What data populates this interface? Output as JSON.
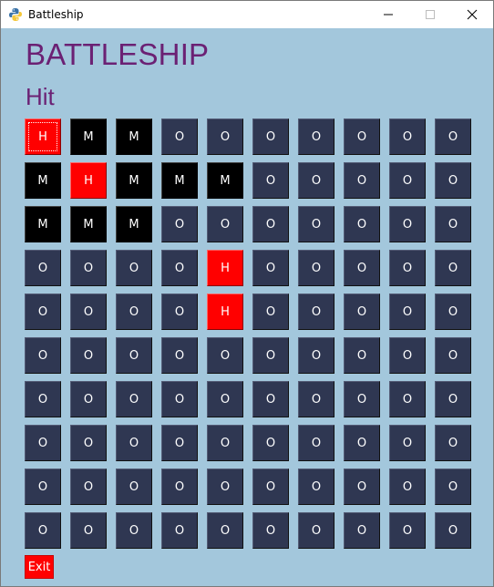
{
  "window": {
    "title": "Battleship",
    "icon": "python-icon"
  },
  "header": {
    "title": "BATTLESHIP",
    "status": "Hit"
  },
  "board": {
    "rows": [
      [
        "H",
        "M",
        "M",
        "O",
        "O",
        "O",
        "O",
        "O",
        "O",
        "O"
      ],
      [
        "M",
        "H",
        "M",
        "M",
        "M",
        "O",
        "O",
        "O",
        "O",
        "O"
      ],
      [
        "M",
        "M",
        "M",
        "O",
        "O",
        "O",
        "O",
        "O",
        "O",
        "O"
      ],
      [
        "O",
        "O",
        "O",
        "O",
        "H",
        "O",
        "O",
        "O",
        "O",
        "O"
      ],
      [
        "O",
        "O",
        "O",
        "O",
        "H",
        "O",
        "O",
        "O",
        "O",
        "O"
      ],
      [
        "O",
        "O",
        "O",
        "O",
        "O",
        "O",
        "O",
        "O",
        "O",
        "O"
      ],
      [
        "O",
        "O",
        "O",
        "O",
        "O",
        "O",
        "O",
        "O",
        "O",
        "O"
      ],
      [
        "O",
        "O",
        "O",
        "O",
        "O",
        "O",
        "O",
        "O",
        "O",
        "O"
      ],
      [
        "O",
        "O",
        "O",
        "O",
        "O",
        "O",
        "O",
        "O",
        "O",
        "O"
      ],
      [
        "O",
        "O",
        "O",
        "O",
        "O",
        "O",
        "O",
        "O",
        "O",
        "O"
      ]
    ],
    "colors": {
      "hit": "#ff0000",
      "miss": "#000000",
      "empty": "#2f3752"
    }
  },
  "footer": {
    "exit_label": "Exit"
  },
  "colors": {
    "background": "#a3c7dc",
    "title": "#6b2174"
  }
}
